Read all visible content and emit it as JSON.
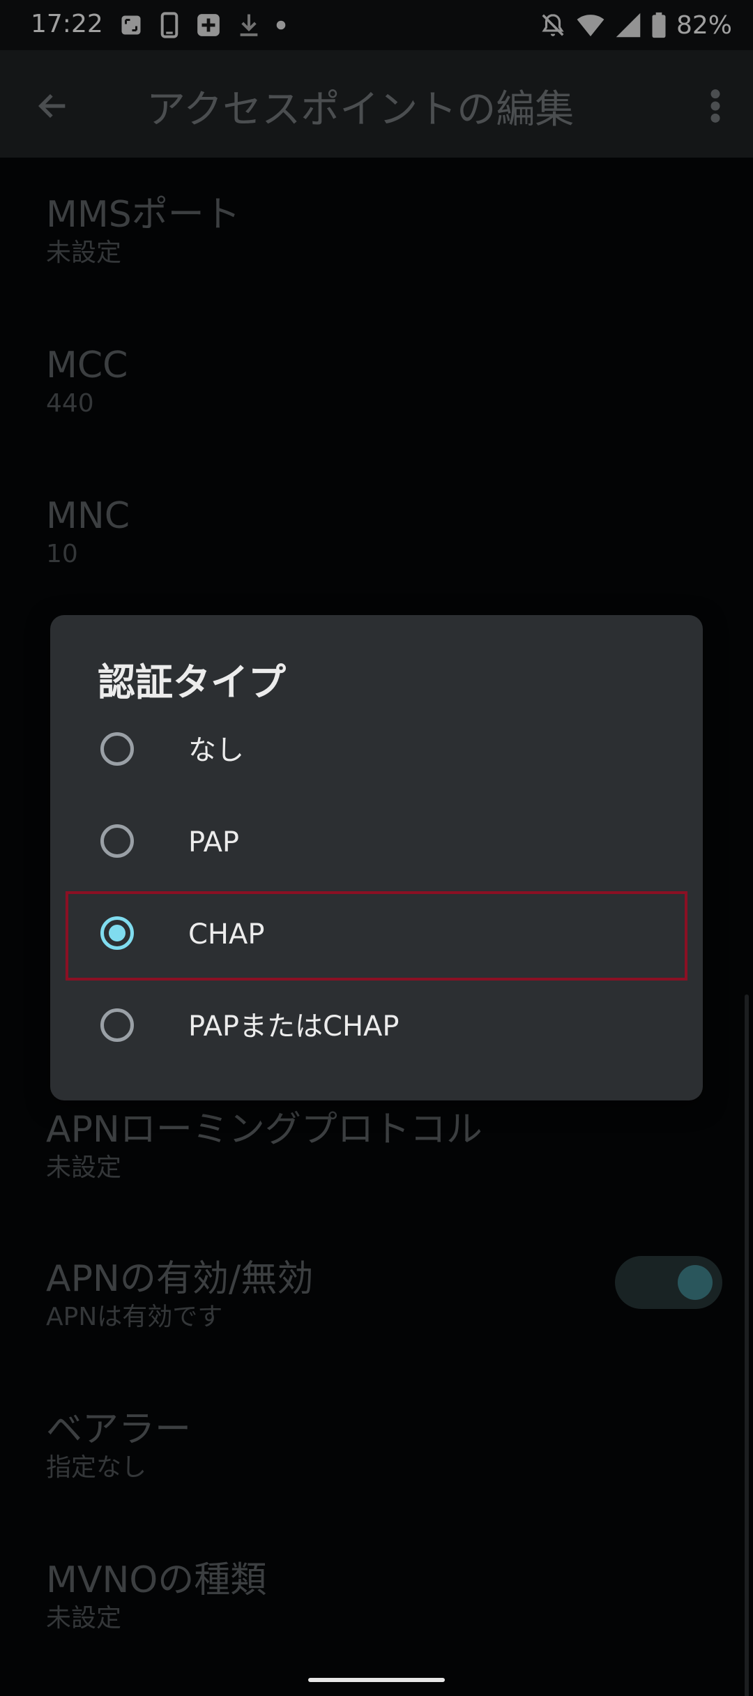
{
  "status_bar": {
    "time": "17:22",
    "battery": "82%",
    "left_icons": [
      "screenshot-icon",
      "phone-icon",
      "plus-box-icon",
      "download-icon",
      "dot-icon"
    ],
    "right_icons": [
      "notification-off-icon",
      "wifi-icon",
      "signal-icon",
      "battery-icon"
    ]
  },
  "app_bar": {
    "title": "アクセスポイントの編集",
    "back_icon": "arrow-back-icon",
    "more_icon": "more-vert-icon"
  },
  "settings": [
    {
      "title": "MMSポート",
      "summary": "未設定"
    },
    {
      "title": "MCC",
      "summary": "440"
    },
    {
      "title": "MNC",
      "summary": "10"
    },
    {
      "title": "APNローミングプロトコル",
      "summary": "未設定"
    },
    {
      "title": "APNの有効/無効",
      "summary": "APNは有効です",
      "switch_on": true
    },
    {
      "title": "ベアラー",
      "summary": "指定なし"
    },
    {
      "title": "MVNOの種類",
      "summary": "未設定"
    }
  ],
  "dialog": {
    "title": "認証タイプ",
    "options": [
      {
        "label": "なし",
        "checked": false
      },
      {
        "label": "PAP",
        "checked": false
      },
      {
        "label": "CHAP",
        "checked": true
      },
      {
        "label": "PAPまたはCHAP",
        "checked": false
      }
    ]
  },
  "colors": {
    "accent": "#80dcef",
    "highlight": "#8b1024",
    "dialog_bg": "#2c2f32"
  }
}
